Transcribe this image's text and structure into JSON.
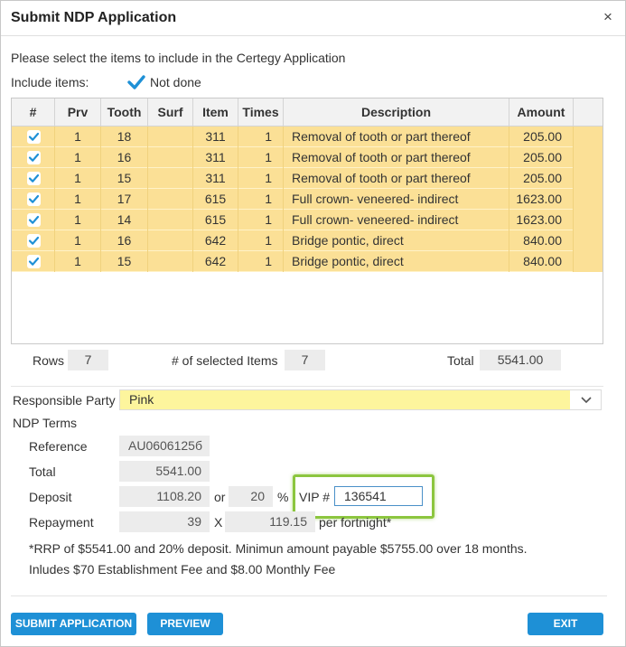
{
  "dialog": {
    "title": "Submit NDP Application",
    "close_glyph": "×",
    "instruction": "Please select the items to include in the Certegy Application",
    "include_items_label": "Include items:",
    "not_done_label": "Not done",
    "not_done_checked": true
  },
  "grid": {
    "columns": [
      "#",
      "Prv",
      "Tooth",
      "Surf",
      "Item",
      "Times",
      "Description",
      "Amount"
    ],
    "rows": [
      {
        "checked": true,
        "prv": "1",
        "tooth": "18",
        "surf": "",
        "item": "311",
        "times": "1",
        "description": "Removal of tooth or part thereof",
        "amount": "205.00"
      },
      {
        "checked": true,
        "prv": "1",
        "tooth": "16",
        "surf": "",
        "item": "311",
        "times": "1",
        "description": "Removal of tooth or part thereof",
        "amount": "205.00"
      },
      {
        "checked": true,
        "prv": "1",
        "tooth": "15",
        "surf": "",
        "item": "311",
        "times": "1",
        "description": "Removal of tooth or part thereof",
        "amount": "205.00"
      },
      {
        "checked": true,
        "prv": "1",
        "tooth": "17",
        "surf": "",
        "item": "615",
        "times": "1",
        "description": "Full crown- veneered- indirect",
        "amount": "1623.00"
      },
      {
        "checked": true,
        "prv": "1",
        "tooth": "14",
        "surf": "",
        "item": "615",
        "times": "1",
        "description": "Full crown- veneered- indirect",
        "amount": "1623.00"
      },
      {
        "checked": true,
        "prv": "1",
        "tooth": "16",
        "surf": "",
        "item": "642",
        "times": "1",
        "description": "Bridge pontic, direct",
        "amount": "840.00"
      },
      {
        "checked": true,
        "prv": "1",
        "tooth": "15",
        "surf": "",
        "item": "642",
        "times": "1",
        "description": "Bridge pontic, direct",
        "amount": "840.00"
      }
    ]
  },
  "summary": {
    "rows_label": "Rows",
    "rows_value": "7",
    "selected_label": "# of selected Items",
    "selected_value": "7",
    "total_label": "Total",
    "total_value": "5541.00"
  },
  "responsible_party": {
    "label": "Responsible Party",
    "value": "Pink"
  },
  "ndp_terms": {
    "heading": "NDP Terms",
    "reference_label": "Reference",
    "reference_value": "AU0606125б",
    "total_label": "Total",
    "total_value": "5541.00",
    "deposit_label": "Deposit",
    "deposit_value": "1108.20",
    "or_label": "or",
    "deposit_percent": "20",
    "percent_sign": "%",
    "vip_label": "VIP #",
    "vip_value": "136541",
    "repayment_label": "Repayment",
    "repayment_count": "39",
    "x_label": "X",
    "repayment_amount": "119.15",
    "per_label": "per fortnight*",
    "note1": "*RRP of $5541.00 and 20% deposit. Minimun amount payable $5755.00 over 18 months.",
    "note2": "Inludes $70 Establishment Fee and $8.00 Monthly Fee"
  },
  "buttons": {
    "submit": "SUBMIT APPLICATION",
    "preview": "PREVIEW",
    "exit": "EXIT"
  },
  "colors": {
    "accent": "#1e90d6",
    "row_highlight": "#fbe096",
    "party_highlight": "#fdf59d",
    "vip_outline": "#8cc63f"
  }
}
